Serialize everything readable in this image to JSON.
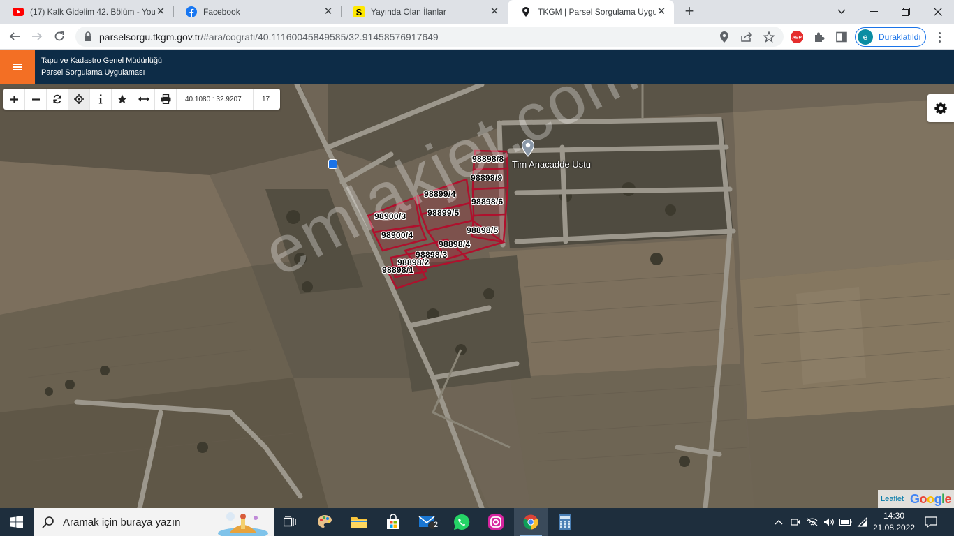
{
  "browser": {
    "tabs": [
      {
        "title": "(17) Kalk Gidelim 42. Bölüm - You",
        "icon": "youtube-icon",
        "active": false
      },
      {
        "title": "Facebook",
        "icon": "facebook-icon",
        "active": false
      },
      {
        "title": "Yayında Olan İlanlar",
        "icon": "sahibinden-icon",
        "active": false
      },
      {
        "title": "TKGM | Parsel Sorgulama Uygulam",
        "icon": "location-pin-icon",
        "active": true
      }
    ],
    "new_tab": "+",
    "url_domain": "parselsorgu.tkgm.gov.tr",
    "url_path": "/#ara/cografi/40.11160045849585/32.91458576917649",
    "profile": {
      "initial": "e",
      "label": "Duraklatıldı"
    }
  },
  "site": {
    "title_line1": "Tapu ve Kadastro Genel Müdürlüğü",
    "title_line2": "Parsel Sorgulama Uygulaması",
    "brand_color": "#f36f24",
    "header_color": "#0d2c47"
  },
  "map_toolbar": {
    "coordinates": "40.1080 : 32.9207",
    "zoom": "17"
  },
  "map": {
    "poi": "Tim Anacadde Ustu",
    "watermark": "emlakjet.com",
    "parcel_color": "#b0102d",
    "parcels": [
      {
        "id": "p1",
        "label": "98898/8"
      },
      {
        "id": "p2",
        "label": "98898/9"
      },
      {
        "id": "p3",
        "label": "98899/4"
      },
      {
        "id": "p4",
        "label": "98898/6"
      },
      {
        "id": "p5",
        "label": "98900/3"
      },
      {
        "id": "p6",
        "label": "98899/5"
      },
      {
        "id": "p7",
        "label": "98898/5"
      },
      {
        "id": "p8",
        "label": "98900/4"
      },
      {
        "id": "p9",
        "label": "98898/4"
      },
      {
        "id": "p10",
        "label": "98898/3"
      },
      {
        "id": "p11",
        "label": "98898/2"
      },
      {
        "id": "p12",
        "label": "98898/1"
      }
    ],
    "attribution_leaflet": "Leaflet",
    "attribution_sep": "|",
    "attribution_google": "Google"
  },
  "taskbar": {
    "search_placeholder": "Aramak için buraya yazın",
    "mail_badge": "2",
    "time": "14:30",
    "date": "21.08.2022"
  }
}
